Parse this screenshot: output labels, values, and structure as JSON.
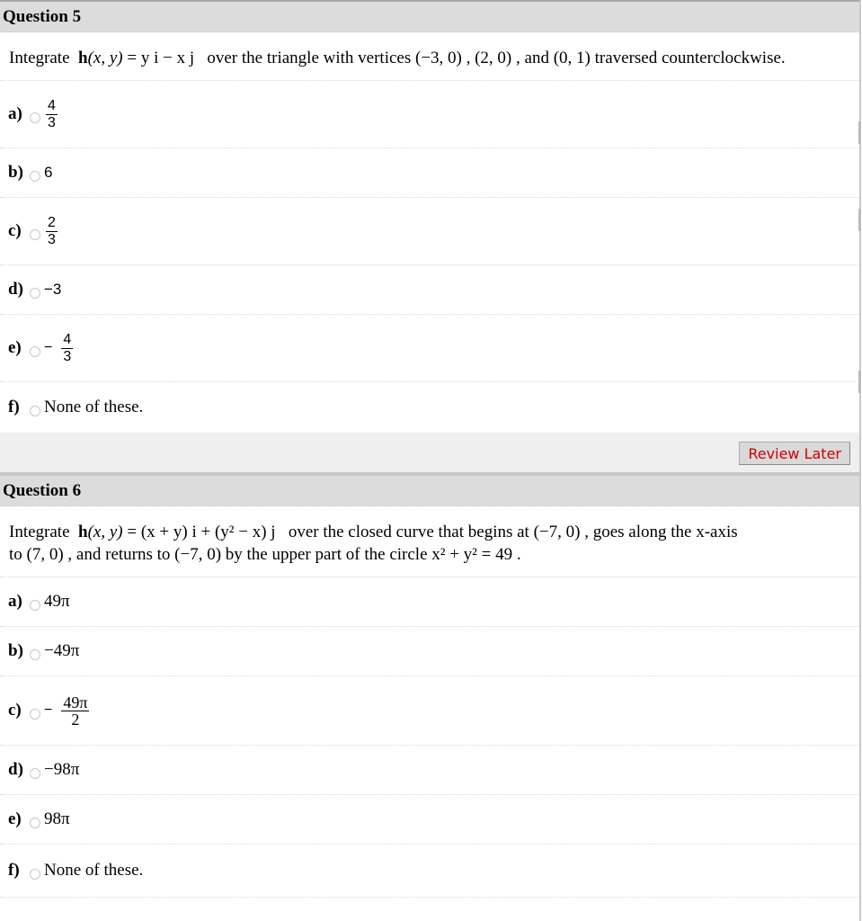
{
  "questions": [
    {
      "title": "Question 5",
      "text": {
        "prefix": "Integrate",
        "func": "h",
        "args": "(x, y)",
        "eq": " = ",
        "expr": "y i − x j",
        "suffix": "over the triangle with vertices (−3, 0) , (2, 0) , and (0, 1)  traversed counterclockwise."
      },
      "options": [
        {
          "letter": "a)",
          "type": "fraction",
          "sign": "",
          "numerator": "4",
          "denominator": "3"
        },
        {
          "letter": "b)",
          "type": "value",
          "value": "6"
        },
        {
          "letter": "c)",
          "type": "fraction",
          "sign": "",
          "numerator": "2",
          "denominator": "3"
        },
        {
          "letter": "d)",
          "type": "value",
          "value": "−3"
        },
        {
          "letter": "e)",
          "type": "fraction",
          "sign": "−",
          "numerator": "4",
          "denominator": "3"
        },
        {
          "letter": "f)",
          "type": "text",
          "value": "None of these."
        }
      ]
    },
    {
      "title": "Question 6",
      "text": {
        "prefix": "Integrate",
        "func": "h",
        "args": "(x, y)",
        "eq": " = ",
        "expr": "(x + y) i + (y² − x) j",
        "suffix_line1": "over the closed curve that begins at (−7, 0) , goes along the x-axis",
        "suffix_line2": "to (7, 0) , and returns to (−7, 0)  by the upper part of the circle x² + y² = 49 ."
      },
      "options": [
        {
          "letter": "a)",
          "type": "value",
          "value": "49π"
        },
        {
          "letter": "b)",
          "type": "value",
          "value": "−49π"
        },
        {
          "letter": "c)",
          "type": "fraction",
          "sign": "−",
          "numerator": "49π",
          "denominator": "2"
        },
        {
          "letter": "d)",
          "type": "value",
          "value": "−98π"
        },
        {
          "letter": "e)",
          "type": "value",
          "value": "98π"
        },
        {
          "letter": "f)",
          "type": "text",
          "value": "None of these."
        }
      ]
    }
  ],
  "review_button": {
    "label": "Review Later",
    "color": "#cc0000"
  }
}
